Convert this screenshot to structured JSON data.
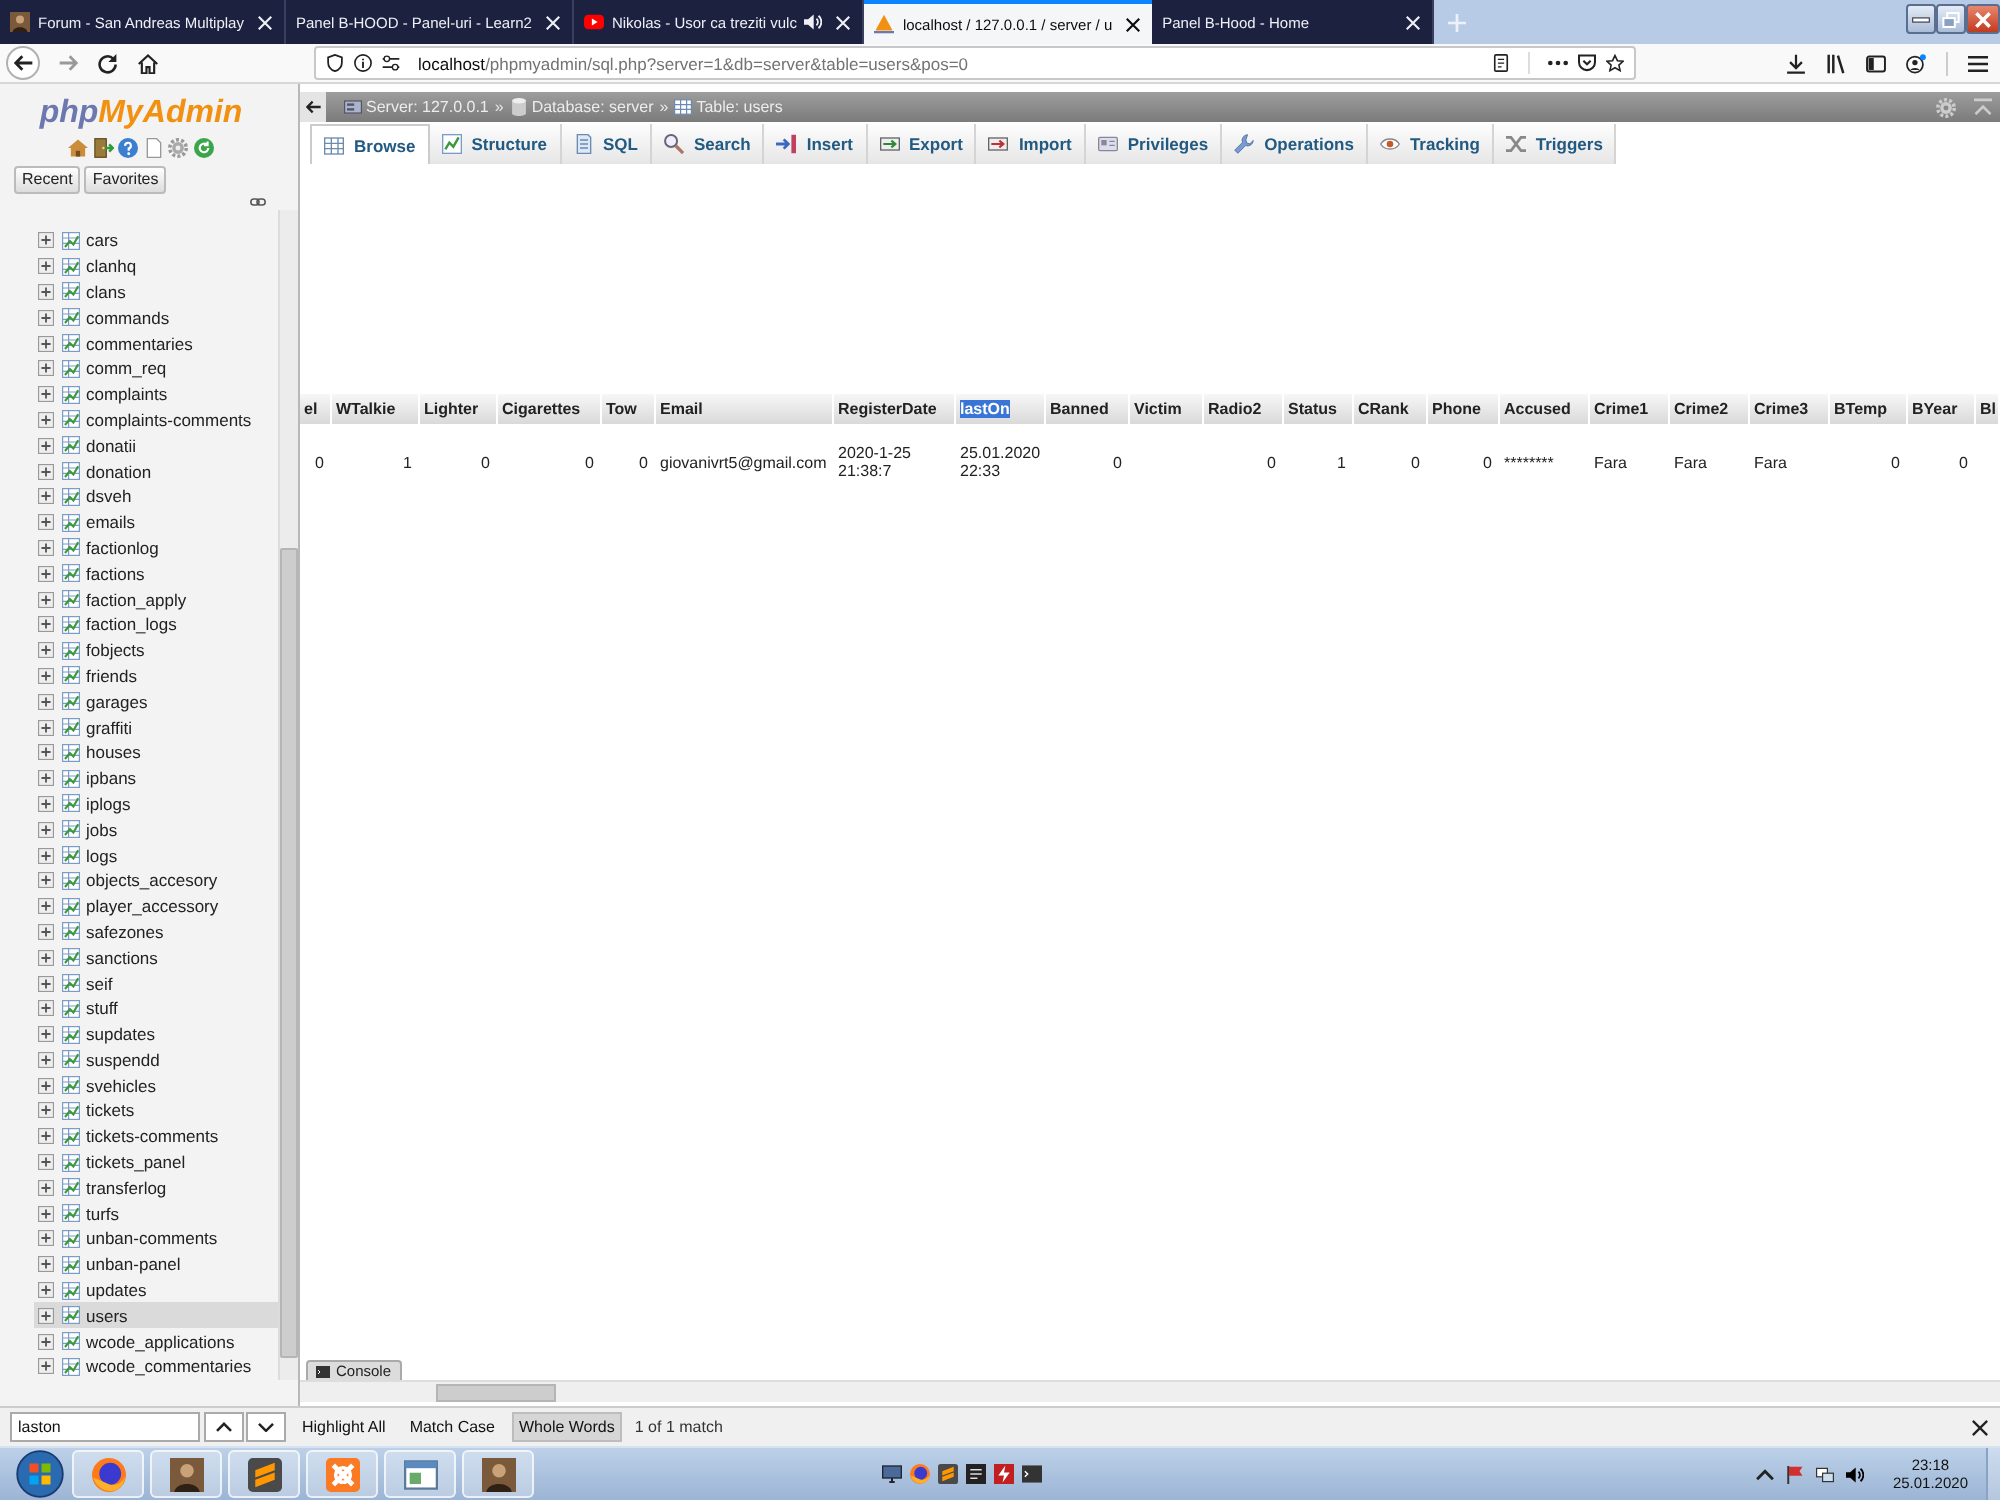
{
  "browser": {
    "tabs": [
      {
        "title": "Forum - San Andreas Multiplay",
        "selected": false,
        "audio": false
      },
      {
        "title": "Panel B-HOOD - Panel-uri - Learn2",
        "selected": false,
        "audio": false
      },
      {
        "title": "Nikolas - Usor ca treziti vulc",
        "selected": false,
        "audio": true
      },
      {
        "title": "localhost / 127.0.0.1 / server / u",
        "selected": true,
        "audio": false
      },
      {
        "title": "Panel B-Hood - Home",
        "selected": false,
        "audio": false
      }
    ],
    "url": {
      "host": "localhost",
      "path": "/phpmyadmin/sql.php?server=1&db=server&table=users&pos=0"
    }
  },
  "sidebar": {
    "logo": [
      "php",
      "MyAdmin"
    ],
    "buttons": [
      "Recent",
      "Favorites"
    ],
    "tables": [
      {
        "name": "cars",
        "selected": false
      },
      {
        "name": "clanhq",
        "selected": false
      },
      {
        "name": "clans",
        "selected": false
      },
      {
        "name": "commands",
        "selected": false
      },
      {
        "name": "commentaries",
        "selected": false
      },
      {
        "name": "comm_req",
        "selected": false
      },
      {
        "name": "complaints",
        "selected": false
      },
      {
        "name": "complaints-comments",
        "selected": false
      },
      {
        "name": "donatii",
        "selected": false
      },
      {
        "name": "donation",
        "selected": false
      },
      {
        "name": "dsveh",
        "selected": false
      },
      {
        "name": "emails",
        "selected": false
      },
      {
        "name": "factionlog",
        "selected": false
      },
      {
        "name": "factions",
        "selected": false
      },
      {
        "name": "faction_apply",
        "selected": false
      },
      {
        "name": "faction_logs",
        "selected": false
      },
      {
        "name": "fobjects",
        "selected": false
      },
      {
        "name": "friends",
        "selected": false
      },
      {
        "name": "garages",
        "selected": false
      },
      {
        "name": "graffiti",
        "selected": false
      },
      {
        "name": "houses",
        "selected": false
      },
      {
        "name": "ipbans",
        "selected": false
      },
      {
        "name": "iplogs",
        "selected": false
      },
      {
        "name": "jobs",
        "selected": false
      },
      {
        "name": "logs",
        "selected": false
      },
      {
        "name": "objects_accesory",
        "selected": false
      },
      {
        "name": "player_accessory",
        "selected": false
      },
      {
        "name": "safezones",
        "selected": false
      },
      {
        "name": "sanctions",
        "selected": false
      },
      {
        "name": "seif",
        "selected": false
      },
      {
        "name": "stuff",
        "selected": false
      },
      {
        "name": "supdates",
        "selected": false
      },
      {
        "name": "suspendd",
        "selected": false
      },
      {
        "name": "svehicles",
        "selected": false
      },
      {
        "name": "tickets",
        "selected": false
      },
      {
        "name": "tickets-comments",
        "selected": false
      },
      {
        "name": "tickets_panel",
        "selected": false
      },
      {
        "name": "transferlog",
        "selected": false
      },
      {
        "name": "turfs",
        "selected": false
      },
      {
        "name": "unban-comments",
        "selected": false
      },
      {
        "name": "unban-panel",
        "selected": false
      },
      {
        "name": "updates",
        "selected": false
      },
      {
        "name": "users",
        "selected": true
      },
      {
        "name": "wcode_applications",
        "selected": false
      },
      {
        "name": "wcode_commentaries",
        "selected": false
      }
    ]
  },
  "main": {
    "breadcrumb": {
      "separator": "»",
      "items": [
        "Server: 127.0.0.1",
        "Database: server",
        "Table: users"
      ]
    },
    "tabs": [
      {
        "label": "Browse",
        "selected": true
      },
      {
        "label": "Structure",
        "selected": false
      },
      {
        "label": "SQL",
        "selected": false
      },
      {
        "label": "Search",
        "selected": false
      },
      {
        "label": "Insert",
        "selected": false
      },
      {
        "label": "Export",
        "selected": false
      },
      {
        "label": "Import",
        "selected": false
      },
      {
        "label": "Privileges",
        "selected": false
      },
      {
        "label": "Operations",
        "selected": false
      },
      {
        "label": "Tracking",
        "selected": false
      },
      {
        "label": "Triggers",
        "selected": false
      }
    ],
    "table": {
      "columns": [
        {
          "label": "el",
          "kind": "number",
          "highlighted": false
        },
        {
          "label": "WTalkie",
          "kind": "number",
          "highlighted": false
        },
        {
          "label": "Lighter",
          "kind": "number",
          "highlighted": false
        },
        {
          "label": "Cigarettes",
          "kind": "number",
          "highlighted": false
        },
        {
          "label": "Tow",
          "kind": "number",
          "highlighted": false
        },
        {
          "label": "Email",
          "kind": "text",
          "highlighted": false
        },
        {
          "label": "RegisterDate",
          "kind": "text",
          "highlighted": false
        },
        {
          "label": "lastOn",
          "kind": "text",
          "highlighted": true
        },
        {
          "label": "Banned",
          "kind": "number",
          "highlighted": false
        },
        {
          "label": "Victim",
          "kind": "text",
          "highlighted": false
        },
        {
          "label": "Radio2",
          "kind": "number",
          "highlighted": false
        },
        {
          "label": "Status",
          "kind": "number",
          "highlighted": false
        },
        {
          "label": "CRank",
          "kind": "number",
          "highlighted": false
        },
        {
          "label": "Phone",
          "kind": "number",
          "highlighted": false
        },
        {
          "label": "Accused",
          "kind": "text",
          "highlighted": false
        },
        {
          "label": "Crime1",
          "kind": "text",
          "highlighted": false
        },
        {
          "label": "Crime2",
          "kind": "text",
          "highlighted": false
        },
        {
          "label": "Crime3",
          "kind": "text",
          "highlighted": false
        },
        {
          "label": "BTemp",
          "kind": "number",
          "highlighted": false
        },
        {
          "label": "BYear",
          "kind": "number",
          "highlighted": false
        },
        {
          "label": "Bl",
          "kind": "text",
          "highlighted": false
        }
      ],
      "rows": [
        [
          "0",
          "1",
          "0",
          "0",
          "0",
          "giovanivrt5@gmail.com",
          "2020-1-25 21:38:7",
          "25.01.2020 22:33",
          "0",
          null,
          "0",
          "1",
          "0",
          "0",
          "********",
          "Fara",
          "Fara",
          "Fara",
          "0",
          "0"
        ]
      ]
    },
    "console": "Console"
  },
  "find_bar": {
    "value": "laston",
    "options": [
      {
        "label": "Highlight All",
        "pressed": false
      },
      {
        "label": "Match Case",
        "pressed": false
      },
      {
        "label": "Whole Words",
        "pressed": true
      }
    ],
    "status": "1 of 1 match"
  },
  "taskbar": {
    "time": "23:18",
    "date": "25.01.2020"
  }
}
